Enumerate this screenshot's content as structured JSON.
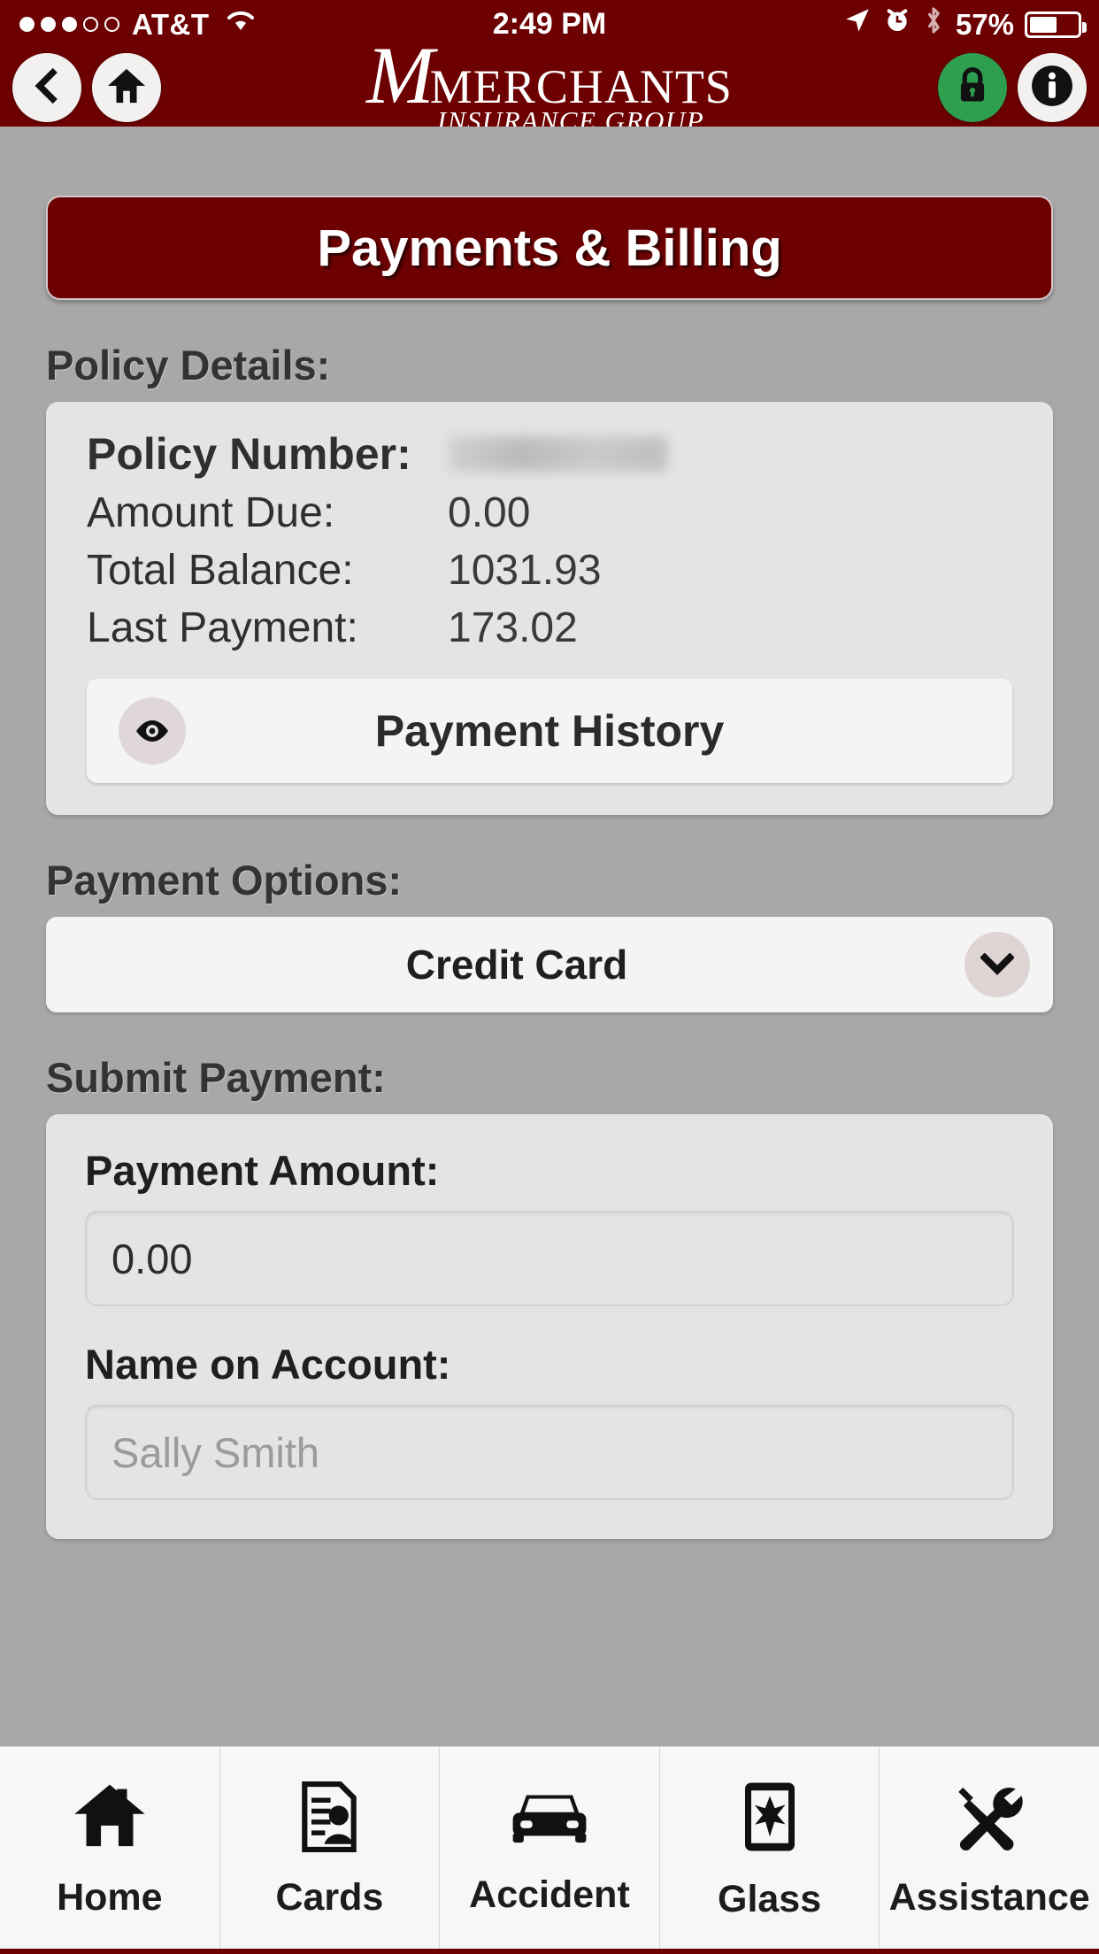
{
  "status_bar": {
    "carrier": "AT&T",
    "signal_dots_filled": 3,
    "signal_dots_total": 5,
    "time": "2:49 PM",
    "battery_percent": "57%",
    "battery_level": 57,
    "icons": [
      "location-arrow-icon",
      "alarm-clock-icon",
      "bluetooth-icon"
    ],
    "background_color": "#6d0000"
  },
  "app_bar": {
    "back_label": "",
    "home_label": "",
    "lock_label": "",
    "info_label": "",
    "logo_initial": "M",
    "logo_name": "MERCHANTS",
    "logo_tagline": "INSURANCE GROUP",
    "lock_color": "#2e9e4f",
    "background_color": "#6d0000"
  },
  "page": {
    "title": "Payments & Billing",
    "title_bg": "#6d0000"
  },
  "policy_details": {
    "heading": "Policy Details:",
    "policy_number_label": "Policy Number:",
    "policy_number_value": "",
    "rows": [
      {
        "label": "Amount Due:",
        "value": "0.00"
      },
      {
        "label": "Total Balance:",
        "value": "1031.93"
      },
      {
        "label": "Last Payment:",
        "value": "173.02"
      }
    ],
    "history_button": "Payment History",
    "history_icon": "eye-icon"
  },
  "payment_options": {
    "heading": "Payment Options:",
    "selected": "Credit Card",
    "chevron_icon": "chevron-down-icon"
  },
  "submit_payment": {
    "heading": "Submit Payment:",
    "amount_label": "Payment Amount:",
    "amount_value": "0.00",
    "name_label": "Name on Account:",
    "name_placeholder": "Sally Smith"
  },
  "tab_bar": {
    "tabs": [
      {
        "label": "Home",
        "icon": "house-icon"
      },
      {
        "label": "Cards",
        "icon": "id-card-document-icon"
      },
      {
        "label": "Accident",
        "icon": "car-front-icon"
      },
      {
        "label": "Glass",
        "icon": "cracked-phone-glass-icon"
      },
      {
        "label": "Assistance",
        "icon": "wrench-screwdriver-icon"
      }
    ]
  }
}
